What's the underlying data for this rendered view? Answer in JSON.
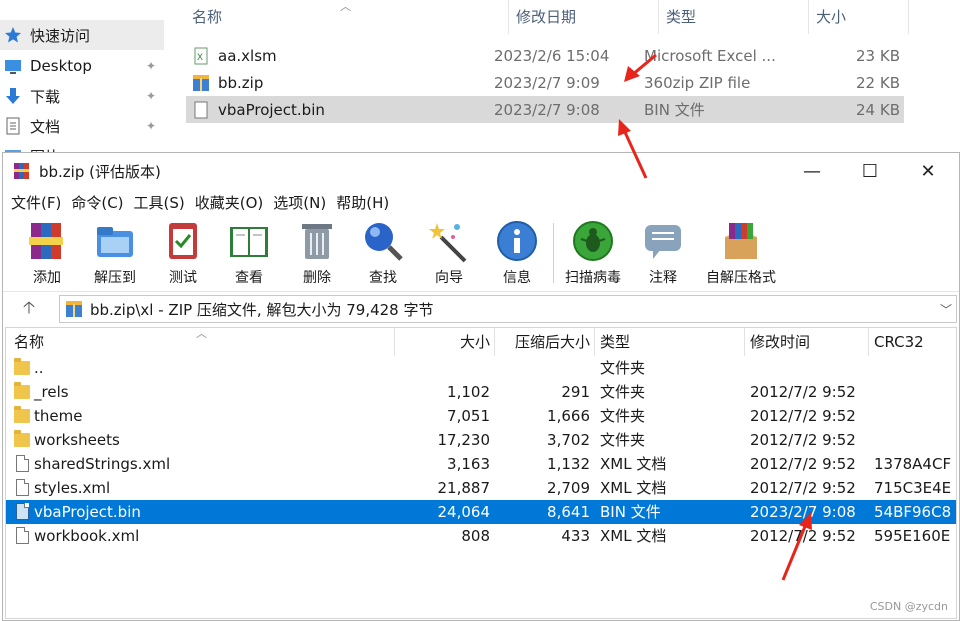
{
  "explorer": {
    "nav": {
      "quick_access": "快速访问",
      "desktop": "Desktop",
      "downloads": "下载",
      "documents": "文档",
      "partial": "图片"
    },
    "columns": {
      "name": "名称",
      "modified": "修改日期",
      "type": "类型",
      "size": "大小"
    },
    "files": [
      {
        "name": "aa.xlsm",
        "modified": "2023/2/6 15:04",
        "type": "Microsoft Excel ...",
        "size": "23 KB"
      },
      {
        "name": "bb.zip",
        "modified": "2023/2/7 9:09",
        "type": "360zip ZIP file",
        "size": "22 KB"
      },
      {
        "name": "vbaProject.bin",
        "modified": "2023/2/7 9:08",
        "type": "BIN 文件",
        "size": "24 KB"
      }
    ]
  },
  "winrar": {
    "title": "bb.zip (评估版本)",
    "menu": [
      "文件(F)",
      "命令(C)",
      "工具(S)",
      "收藏夹(O)",
      "选项(N)",
      "帮助(H)"
    ],
    "toolbar": [
      "添加",
      "解压到",
      "测试",
      "查看",
      "删除",
      "查找",
      "向导",
      "信息",
      "扫描病毒",
      "注释",
      "自解压格式"
    ],
    "address": "bb.zip\\xl - ZIP 压缩文件, 解包大小为 79,428 字节",
    "columns": {
      "name": "名称",
      "size": "大小",
      "packed": "压缩后大小",
      "type": "类型",
      "modified": "修改时间",
      "crc": "CRC32"
    },
    "rows": [
      {
        "name": "..",
        "size": "",
        "packed": "",
        "type": "文件夹",
        "modified": "",
        "crc": "",
        "kind": "folder"
      },
      {
        "name": "_rels",
        "size": "1,102",
        "packed": "291",
        "type": "文件夹",
        "modified": "2012/7/2 9:52",
        "crc": "",
        "kind": "folder"
      },
      {
        "name": "theme",
        "size": "7,051",
        "packed": "1,666",
        "type": "文件夹",
        "modified": "2012/7/2 9:52",
        "crc": "",
        "kind": "folder"
      },
      {
        "name": "worksheets",
        "size": "17,230",
        "packed": "3,702",
        "type": "文件夹",
        "modified": "2012/7/2 9:52",
        "crc": "",
        "kind": "folder"
      },
      {
        "name": "sharedStrings.xml",
        "size": "3,163",
        "packed": "1,132",
        "type": "XML 文档",
        "modified": "2012/7/2 9:52",
        "crc": "1378A4CF",
        "kind": "doc"
      },
      {
        "name": "styles.xml",
        "size": "21,887",
        "packed": "2,709",
        "type": "XML 文档",
        "modified": "2012/7/2 9:52",
        "crc": "715C3E4E",
        "kind": "doc"
      },
      {
        "name": "vbaProject.bin",
        "size": "24,064",
        "packed": "8,641",
        "type": "BIN 文件",
        "modified": "2023/2/7 9:08",
        "crc": "54BF96C8",
        "kind": "doc"
      },
      {
        "name": "workbook.xml",
        "size": "808",
        "packed": "433",
        "type": "XML 文档",
        "modified": "2012/7/2 9:52",
        "crc": "595E160E",
        "kind": "doc"
      }
    ]
  },
  "watermark": "CSDN @zycdn",
  "colors": {
    "selection": "#0078d7",
    "arrow": "#e8251b",
    "explorer_selected": "#d9d9d9"
  }
}
